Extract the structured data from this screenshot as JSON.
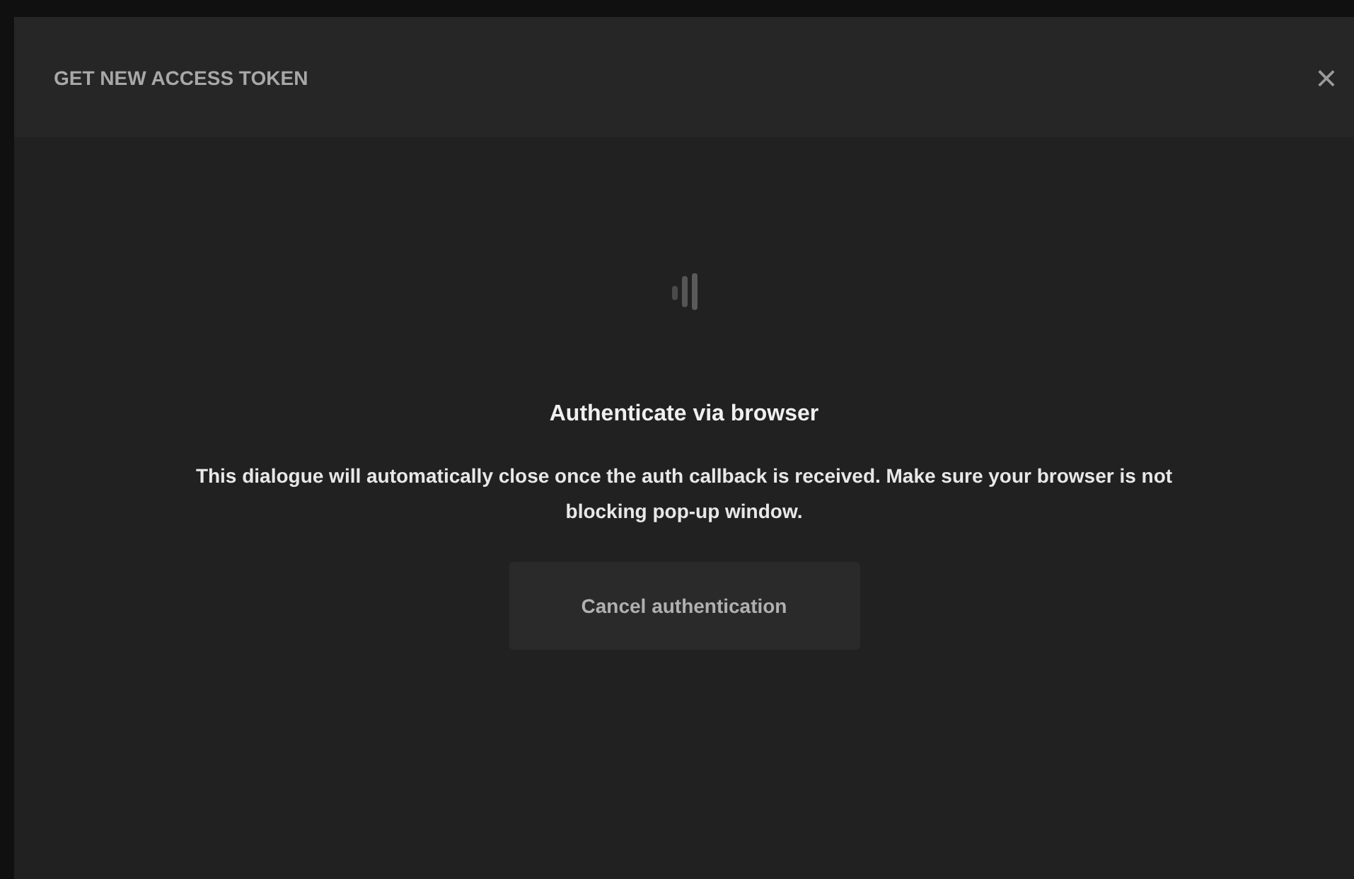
{
  "dialog": {
    "title": "GET NEW ACCESS TOKEN",
    "close": "×"
  },
  "body": {
    "heading": "Authenticate via browser",
    "message": "This dialogue will automatically close once the auth callback is received. Make sure your browser is not blocking pop-up window.",
    "button": "Cancel authentication"
  }
}
